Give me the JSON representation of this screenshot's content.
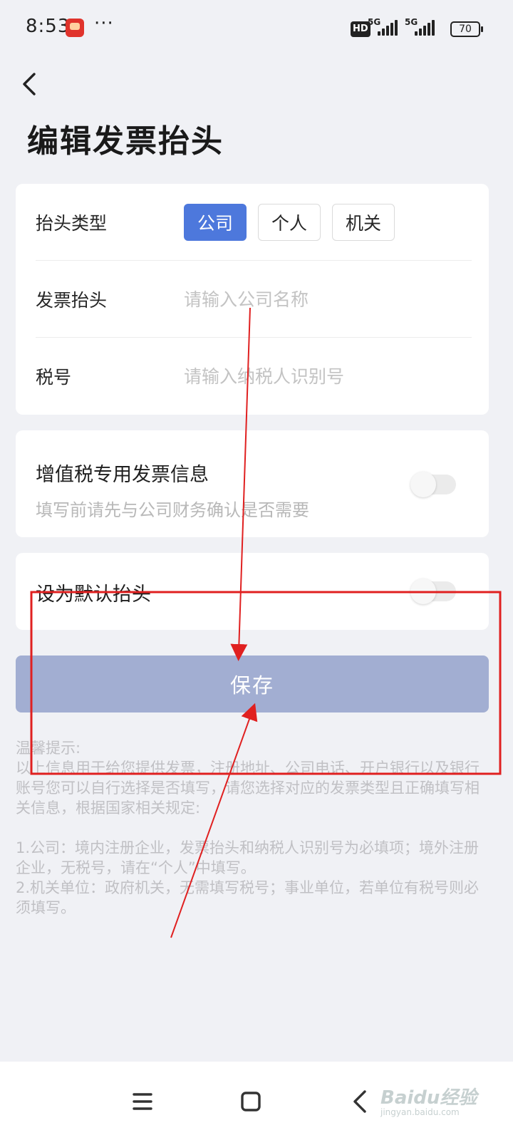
{
  "status_bar": {
    "time": "8:53",
    "more": "···",
    "hd": "HD",
    "network_1": "5G",
    "network_2": "5G",
    "battery": "70"
  },
  "header": {
    "back_icon": "chevron-left-icon",
    "title": "编辑发票抬头"
  },
  "form": {
    "type_label": "抬头类型",
    "type_options": [
      "公司",
      "个人",
      "机关"
    ],
    "selected_type": "公司",
    "title_label": "发票抬头",
    "title_placeholder": "请输入公司名称",
    "tax_label": "税号",
    "tax_placeholder": "请输入纳税人识别号"
  },
  "vat": {
    "title": "增值税专用发票信息",
    "subtitle": "填写前请先与公司财务确认是否需要",
    "enabled": false
  },
  "default_header": {
    "title": "设为默认抬头",
    "enabled": false
  },
  "save_label": "保存",
  "tips": "温馨提示:\n以上信息用于给您提供发票，注册地址、公司电话、开户银行以及银行账号您可以自行选择是否填写，请您选择对应的发票类型且正确填写相关信息，根据国家相关规定:\n\n1.公司：境内注册企业，发票抬头和纳税人识别号为必填项；境外注册企业，无税号，请在“个人”中填写。\n2.机关单位：政府机关，无需填写税号；事业单位，若单位有税号则必须填写。",
  "nav": {
    "menu_icon": "menu-icon",
    "home_icon": "home-square-icon",
    "back_icon": "back-triangle-icon"
  },
  "watermark": {
    "brand": "Baidu经验",
    "url": "jingyan.baidu.com"
  },
  "colors": {
    "accent": "#4d78dc",
    "save_disabled": "#a2aed2",
    "annotation": "#e02020"
  }
}
